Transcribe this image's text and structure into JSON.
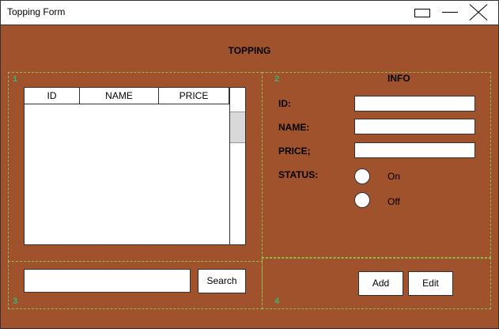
{
  "window": {
    "title": "Topping Form"
  },
  "heading": "TOPPING",
  "panels": {
    "p1": "1",
    "p2": "2",
    "p3": "3",
    "p4": "4"
  },
  "table": {
    "columns": [
      "ID",
      "NAME",
      "PRICE"
    ],
    "rows": []
  },
  "info": {
    "title": "INFO",
    "id_label": "ID:",
    "name_label": "NAME:",
    "price_label": "PRICE;",
    "status_label": "STATUS:",
    "id_value": "",
    "name_value": "",
    "price_value": "",
    "status_options": [
      "On",
      "Off"
    ]
  },
  "search": {
    "value": "",
    "button_label": "Search"
  },
  "actions": {
    "add_label": "Add",
    "edit_label": "Edit"
  }
}
